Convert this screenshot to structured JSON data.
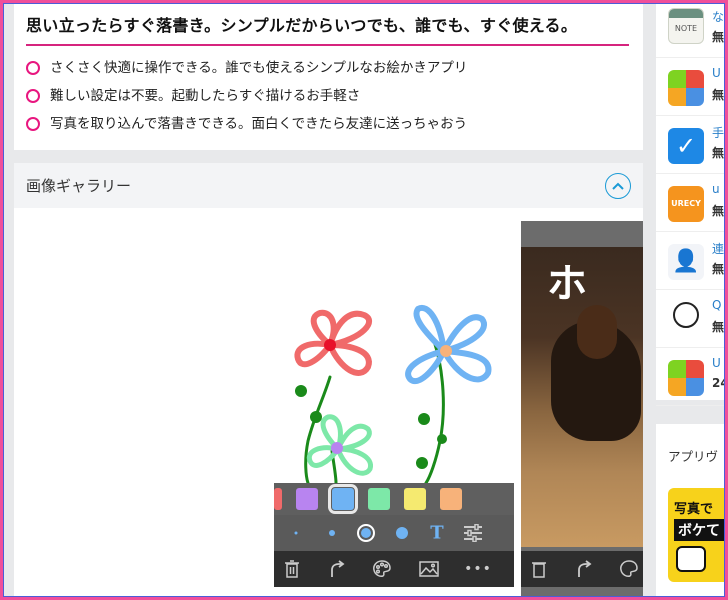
{
  "features": {
    "title": "思い立ったらすぐ落書き。シンプルだからいつでも、誰でも、すぐ使える。",
    "items": [
      "さくさく快適に操作できる。誰でも使えるシンプルなお絵かきアプリ",
      "難しい設定は不要。起動したらすぐ描けるお手軽さ",
      "写真を取り込んで落書きできる。面白くできたら友達に送っちゃおう"
    ]
  },
  "gallery": {
    "title": "画像ギャラリー",
    "palette_colors": [
      "#f06a6a",
      "#b884f0",
      "#6fb3f3",
      "#7de8a8",
      "#f5ea70",
      "#f7b27a"
    ],
    "selected_color": "#6fb3f3",
    "shot2_text": "ホ"
  },
  "sidebar": {
    "items": [
      {
        "name": "な",
        "price": "無",
        "icon": "note-calendar-icon"
      },
      {
        "name": "U",
        "price": "無",
        "icon": "calendar-app-icon"
      },
      {
        "name": "手",
        "price": "無",
        "icon": "checkbox-app-icon"
      },
      {
        "name": "u",
        "price": "無",
        "icon": "urecy-app-icon"
      },
      {
        "name": "連",
        "price": "無",
        "icon": "contacts-app-icon"
      },
      {
        "name": "Q",
        "price": "無",
        "icon": "qr-app-icon"
      },
      {
        "name": "U",
        "price": "24",
        "icon": "calendar-app-icon-2"
      }
    ],
    "section_title": "アプリヴ",
    "banner_line1": "写真で",
    "banner_line2": "ボケて"
  }
}
